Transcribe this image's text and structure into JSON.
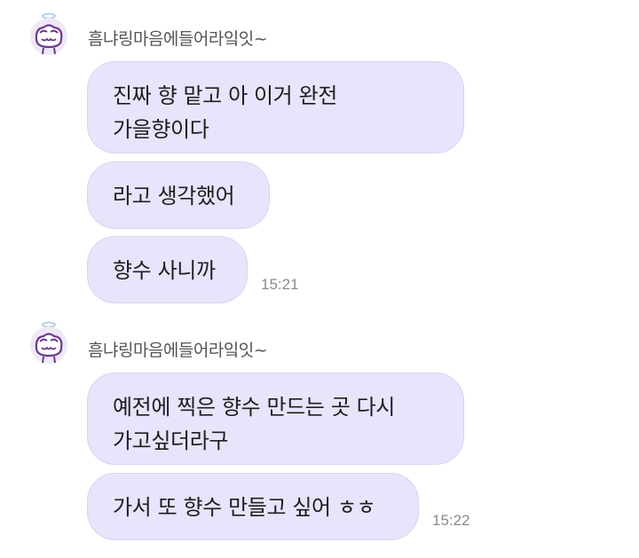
{
  "groups": [
    {
      "sender": "흠냐링마음에들어라잌잇~",
      "messages": [
        {
          "text": "진짜 향 맡고 아 이거 완전\n가을향이다"
        },
        {
          "text": "라고 생각했어"
        },
        {
          "text": "향수 사니까",
          "time": "15:21"
        }
      ]
    },
    {
      "sender": "흠냐링마음에들어라잌잇~",
      "messages": [
        {
          "text": "예전에 찍은 향수 만드는 곳 다시\n가고싶더라구"
        },
        {
          "text": "가서 또 향수 만들고 싶어 ㅎㅎ",
          "time": "15:22"
        }
      ]
    }
  ]
}
